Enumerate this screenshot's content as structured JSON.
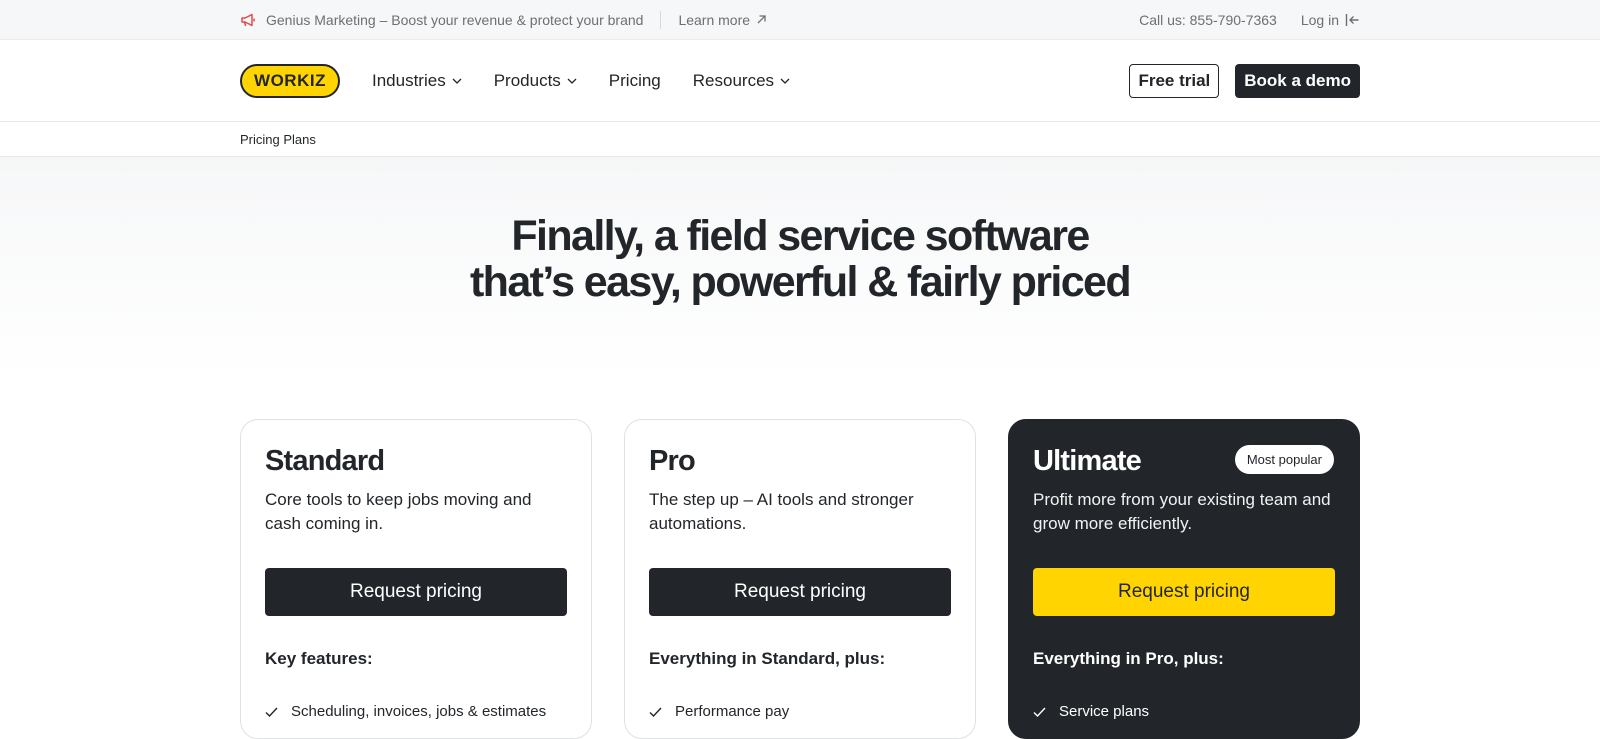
{
  "topbar": {
    "promo_text": "Genius Marketing – Boost your revenue & protect your brand",
    "learn_more": "Learn more",
    "phone": "Call us: 855-790-7363",
    "login": "Log in"
  },
  "nav": {
    "logo_text": "WORKIZ",
    "menu": [
      {
        "label": "Industries",
        "dropdown": true
      },
      {
        "label": "Products",
        "dropdown": true
      },
      {
        "label": "Pricing",
        "dropdown": false
      },
      {
        "label": "Resources",
        "dropdown": true
      }
    ],
    "free_trial": "Free trial",
    "book_demo": "Book a demo"
  },
  "breadcrumb": {
    "current": "Pricing Plans"
  },
  "hero": {
    "line1": "Finally, a field service software",
    "line2": "that’s easy, powerful & fairly priced"
  },
  "plans": [
    {
      "name": "Standard",
      "description": "Core tools to keep jobs moving and cash coming in.",
      "cta": "Request pricing",
      "features_heading": "Key features:",
      "first_feature": "Scheduling, invoices, jobs & estimates"
    },
    {
      "name": "Pro",
      "description": "The step up – AI tools and stronger automations.",
      "cta": "Request pricing",
      "features_heading": "Everything in Standard, plus:",
      "first_feature": "Performance pay"
    },
    {
      "name": "Ultimate",
      "badge": "Most popular",
      "description": "Profit more from your existing team and grow more efficiently.",
      "cta": "Request pricing",
      "features_heading": "Everything in Pro, plus:",
      "first_feature": "Service plans"
    }
  ],
  "colors": {
    "brand_yellow": "#ffd400",
    "dark": "#22262a",
    "promo_icon_red": "#e5484d"
  }
}
